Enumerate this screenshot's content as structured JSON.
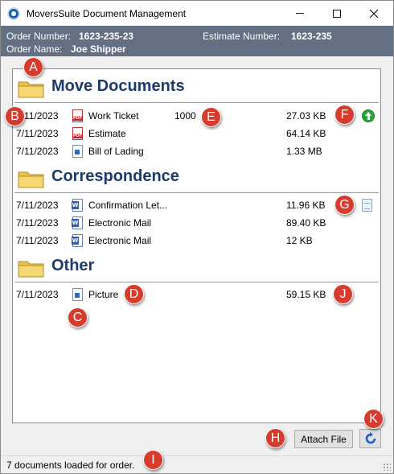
{
  "window": {
    "title": "MoversSuite Document Management"
  },
  "header": {
    "order_number_label": "Order Number:",
    "order_number": "1623-235-23",
    "estimate_number_label": "Estimate Number:",
    "estimate_number": "1623-235",
    "order_name_label": "Order Name:",
    "order_name": "Joe Shipper"
  },
  "groups": [
    {
      "title": "Move Documents",
      "rows": [
        {
          "date": "7/11/2023",
          "icon": "pdf-icon",
          "name": "Work Ticket",
          "number": "1000",
          "size": "27.03 KB",
          "action_icon": "upload-icon"
        },
        {
          "date": "7/11/2023",
          "icon": "pdf-icon",
          "name": "Estimate",
          "number": "",
          "size": "64.14 KB"
        },
        {
          "date": "7/11/2023",
          "icon": "document-icon",
          "name": "Bill of Lading",
          "number": "",
          "size": "1.33 MB"
        }
      ]
    },
    {
      "title": "Correspondence",
      "rows": [
        {
          "date": "7/11/2023",
          "icon": "word-icon",
          "name": "Confirmation Let...",
          "number": "",
          "size": "11.96 KB",
          "action_icon": "note-icon"
        },
        {
          "date": "7/11/2023",
          "icon": "word-icon",
          "name": "Electronic Mail",
          "number": "",
          "size": "89.40 KB"
        },
        {
          "date": "7/11/2023",
          "icon": "word-icon",
          "name": "Electronic Mail",
          "number": "",
          "size": "12 KB"
        }
      ]
    },
    {
      "title": "Other",
      "rows": [
        {
          "date": "7/11/2023",
          "icon": "document-icon",
          "name": "Picture",
          "number": "",
          "size": "59.15 KB"
        }
      ]
    }
  ],
  "buttons": {
    "attach_file": "Attach File"
  },
  "status": {
    "text": "7 documents loaded for order."
  },
  "callouts": [
    "A",
    "B",
    "C",
    "D",
    "E",
    "F",
    "G",
    "H",
    "I",
    "J",
    "K"
  ],
  "colors": {
    "header_bg": "#636f82",
    "group_title": "#1c3a6e",
    "callout": "#d83b2b"
  }
}
